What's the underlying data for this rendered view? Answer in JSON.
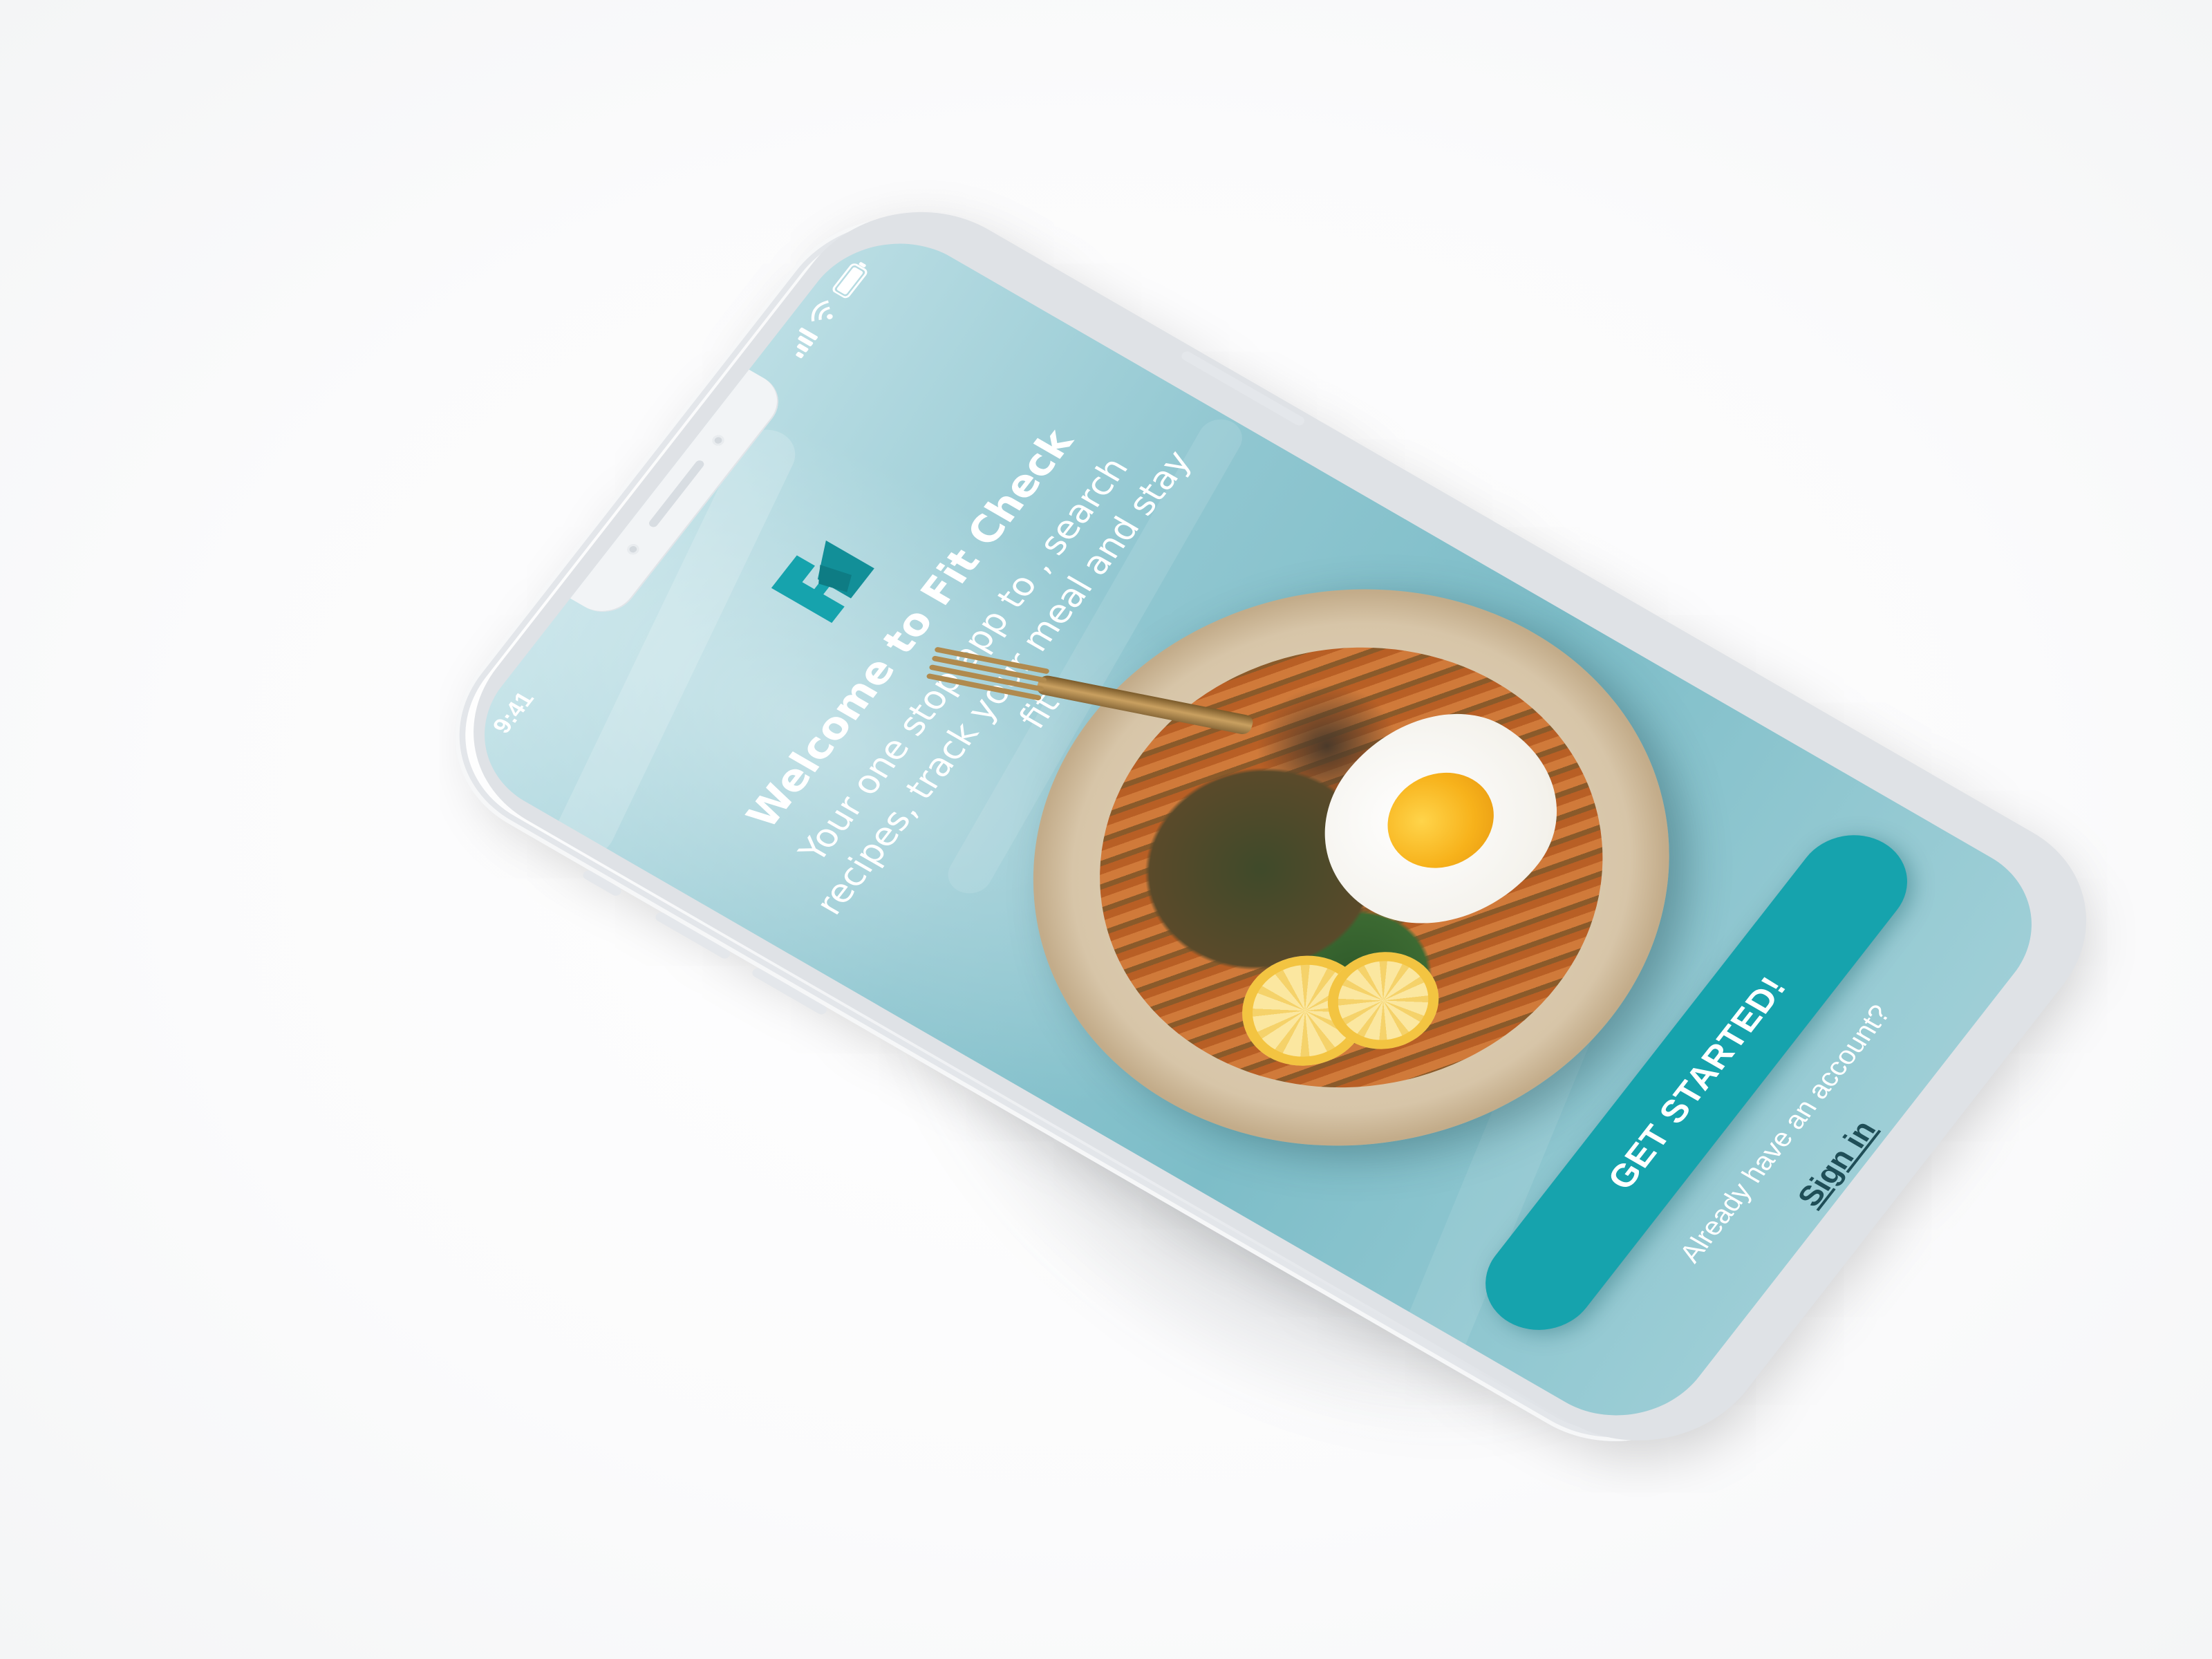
{
  "status_bar": {
    "time": "9:41",
    "signal_icon": "signal-icon",
    "wifi_icon": "wifi-icon",
    "battery_icon": "battery-icon"
  },
  "app": {
    "logo_icon": "fit-check-logo-icon",
    "brand_color": "#16a3ad",
    "title": "Welcome to Fit Check",
    "subtitle": "Your one stop app to , search recipes, track your meal and stay fit!"
  },
  "actions": {
    "get_started_label": "GET STARTED!",
    "account_prompt": "Already have an account?",
    "sign_in_label": "Sign in"
  },
  "hero_image": {
    "description_icon": "food-bowl-image"
  }
}
